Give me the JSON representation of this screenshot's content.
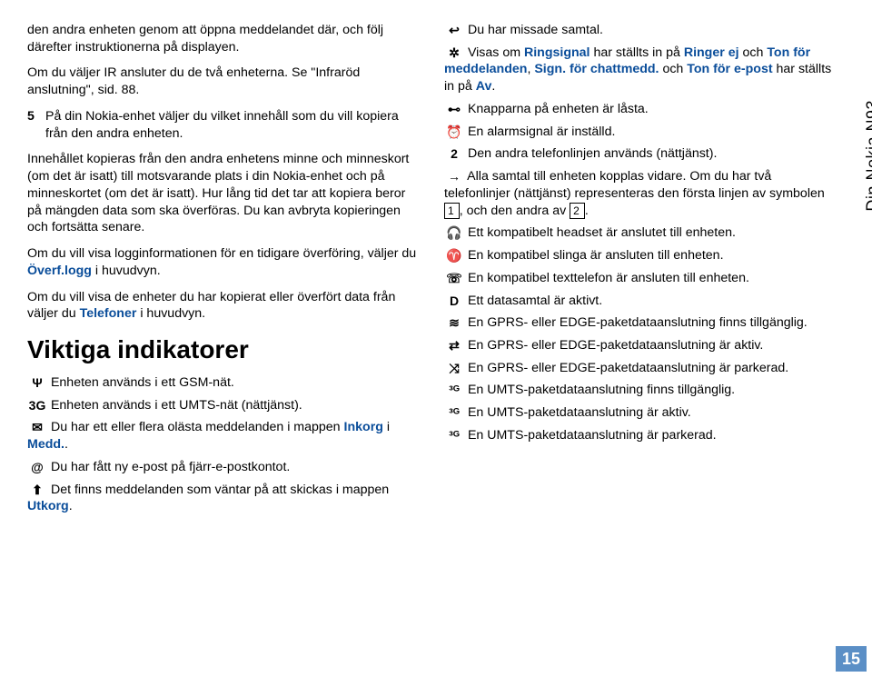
{
  "left": {
    "p1": "den andra enheten genom att öppna meddelandet där, och följ därefter instruktionerna på displayen.",
    "p2a": "Om du väljer IR ansluter du de två enheterna. Se \"Infraröd anslutning\", sid. 88.",
    "step5num": "5",
    "step5": "På din Nokia-enhet väljer du vilket innehåll som du vill kopiera från den andra enheten.",
    "p3": "Innehållet kopieras från den andra enhetens minne och minneskort (om det är isatt) till motsvarande plats i din Nokia-enhet och på minneskortet (om det är isatt). Hur lång tid det tar att kopiera beror på mängden data som ska överföras. Du kan avbryta kopieringen och fortsätta senare.",
    "p4a": "Om du vill visa logginformationen för en tidigare överföring, väljer du ",
    "p4b": "Överf.logg",
    "p4c": " i huvudvyn.",
    "p5a": "Om du vill visa de enheter du har kopierat eller överfört data från väljer du ",
    "p5b": "Telefoner",
    "p5c": " i huvudvyn.",
    "h1": "Viktiga indikatorer",
    "i_gsm_sym": "Ψ",
    "i_gsm": "Enheten används i ett GSM-nät.",
    "i_3g_sym": "3G",
    "i_3g": "Enheten används i ett UMTS-nät (nättjänst).",
    "i_msg_sym": "✉",
    "i_msg_a": "Du har ett eller flera olästa meddelanden i mappen ",
    "i_msg_b": "Inkorg",
    "i_msg_c": " i ",
    "i_msg_d": "Medd.",
    "i_msg_e": ".",
    "i_mail_sym": "@",
    "i_mail": "Du har fått ny e-post på fjärr-e-postkontot.",
    "i_out_sym": "⬆",
    "i_out_a": "Det finns meddelanden som väntar på att skickas i mappen ",
    "i_out_b": "Utkorg",
    "i_out_c": "."
  },
  "right": {
    "i_missed_sym": "↩",
    "i_missed": "Du har missade samtal.",
    "i_ring_sym": "✲",
    "i_ring_a": "Visas om ",
    "i_ring_b": "Ringsignal",
    "i_ring_c": " har ställts in på ",
    "i_ring_d": "Ringer ej",
    "i_ring_e": " och ",
    "i_ring_f": "Ton för meddelanden",
    "i_ring_g": ", ",
    "i_ring_h": "Sign. för chattmedd.",
    "i_ring_i": " och ",
    "i_ring_j": "Ton för e-post",
    "i_ring_k": " har ställts in på ",
    "i_ring_l": "Av",
    "i_ring_m": ".",
    "i_lock_sym": "⊷",
    "i_lock": "Knapparna på enheten är låsta.",
    "i_alarm_sym": "⏰",
    "i_alarm": "En alarmsignal är inställd.",
    "i_line2_sym": "2",
    "i_line2": "Den andra telefonlinjen används (nättjänst).",
    "i_fwd_sym": "→",
    "i_fwd_a": "Alla samtal till enheten kopplas vidare. Om du har två telefonlinjer (nättjänst) representeras den första linjen av symbolen ",
    "i_fwd_b1": "1",
    "i_fwd_c": ", och den andra av ",
    "i_fwd_b2": "2",
    "i_fwd_d": ".",
    "i_hs_sym": "🎧",
    "i_hs": "Ett kompatibelt headset är anslutet till enheten.",
    "i_loop_sym": "♈",
    "i_loop": "En kompatibel slinga är ansluten till enheten.",
    "i_tty_sym": "☏",
    "i_tty": "En kompatibel texttelefon är ansluten till enheten.",
    "i_data_sym": "D",
    "i_data": "Ett datasamtal är aktivt.",
    "i_gprs1_sym": "≋",
    "i_gprs1": "En GPRS- eller EDGE-paketdataanslutning finns tillgänglig.",
    "i_gprs2_sym": "⇄",
    "i_gprs2": "En GPRS- eller EDGE-paketdataanslutning är aktiv.",
    "i_gprs3_sym": "⤨",
    "i_gprs3": "En GPRS- eller EDGE-paketdataanslutning är parkerad.",
    "i_umts1_sym": "³ᴳ",
    "i_umts1": "En UMTS-paketdataanslutning finns tillgänglig.",
    "i_umts2_sym": "³ᴳ",
    "i_umts2": "En UMTS-paketdataanslutning är aktiv.",
    "i_umts3_sym": "³ᴳ",
    "i_umts3": "En UMTS-paketdataanslutning är parkerad."
  },
  "sidebar": "Din Nokia N93",
  "pagenum": "15"
}
